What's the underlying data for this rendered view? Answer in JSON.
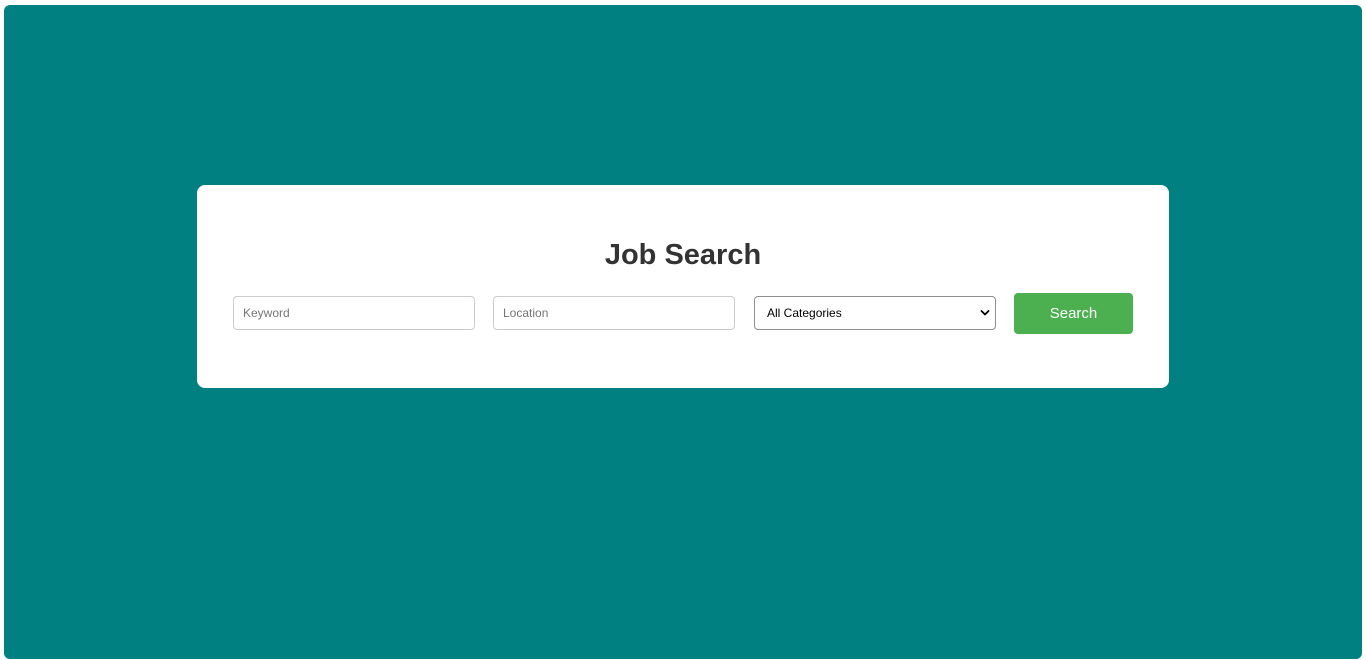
{
  "search_card": {
    "title": "Job Search",
    "keyword": {
      "placeholder": "Keyword",
      "value": ""
    },
    "location": {
      "placeholder": "Location",
      "value": ""
    },
    "category": {
      "selected": "All Categories",
      "icon": "chevron-down-icon"
    },
    "search_label": "Search"
  },
  "colors": {
    "background": "#008080",
    "card": "#ffffff",
    "button": "#4caf50",
    "title": "#333333"
  }
}
